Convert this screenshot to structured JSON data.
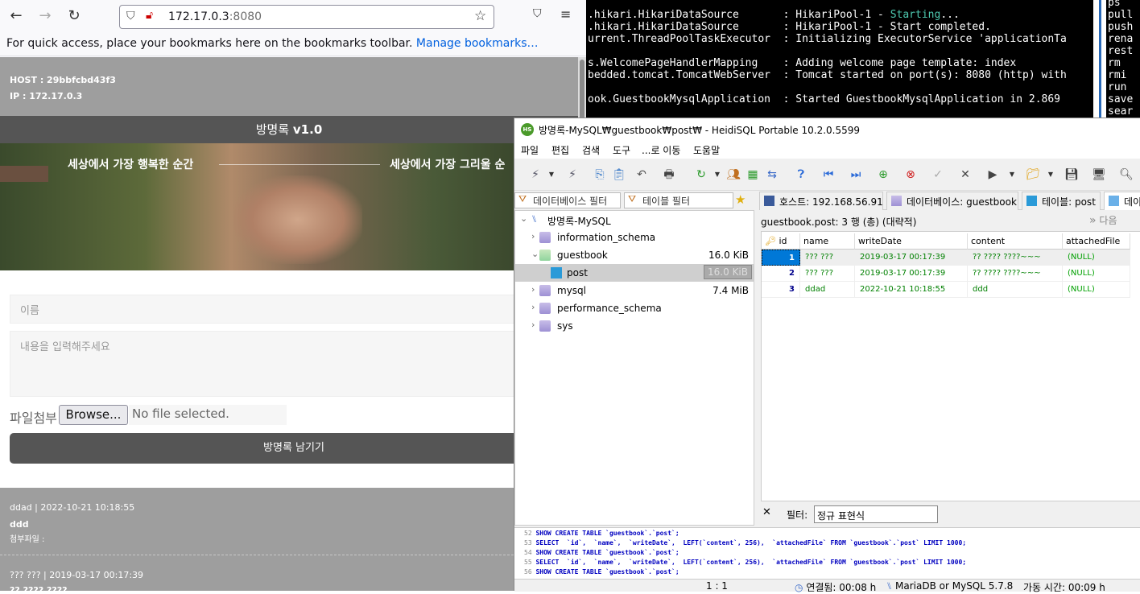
{
  "browser": {
    "url_host": "172.17.0.3",
    "url_port": ":8080",
    "bookmarks_message": "For quick access, place your bookmarks here on the bookmarks toolbar.",
    "manage_bookmarks": "Manage bookmarks…"
  },
  "guestbook": {
    "host": "HOST : 29bbfcbd43f3",
    "ip": "IP : 172.17.0.3",
    "title_prefix": "방명록 ",
    "title_version": "v1.0",
    "hero_text_left": "세상에서 가장 행복한 순간",
    "hero_text_right": "세상에서 가장 그리울 순",
    "name_placeholder": "이름",
    "content_placeholder": "내용을 입력해주세요",
    "attach_label": "파일첨부",
    "browse_label": "Browse...",
    "no_file": "No file selected.",
    "submit_label": "방명록 남기기",
    "entries": [
      {
        "meta": "ddad |   2022-10-21 10:18:55",
        "content": "ddd",
        "file": "첨부파일 :"
      },
      {
        "meta": "??? ??? |   2019-03-17 00:17:39",
        "content": "?? ???? ????"
      }
    ]
  },
  "terminal": {
    "lines": [
      {
        "a": ".hikari.HikariDataSource       : HikariPool-1 - ",
        "b": "Starting",
        "c": "..."
      },
      {
        "a": ".hikari.HikariDataSource       : HikariPool-1 - Start completed."
      },
      {
        "a": "urrent.ThreadPoolTaskExecutor  : Initializing ExecutorService 'applicationTa"
      },
      {
        "a": ""
      },
      {
        "a": "s.WelcomePageHandlerMapping    : Adding welcome page template: index"
      },
      {
        "a": "bedded.tomcat.TomcatWebServer  : Tomcat started on port(s): 8080 (http) with"
      },
      {
        "a": ""
      },
      {
        "a": "ook.GuestbookMysqlApplication  : Started GuestbookMysqlApplication in 2.869"
      }
    ],
    "right_lines": [
      "ps",
      "pull",
      "push",
      "rena",
      "rest",
      "rm",
      "rmi",
      "run",
      "save",
      "sear"
    ]
  },
  "heidisql": {
    "window_title": "방명록-MySQL₩guestbook₩post₩ - HeidiSQL Portable 10.2.0.5599",
    "logo": "HS",
    "menus": [
      "파일",
      "편집",
      "검색",
      "도구",
      "...로 이동",
      "도움말"
    ],
    "db_filter": "데이터베이스 필터",
    "table_filter": "테이블 필터",
    "tabs": [
      "호스트: 192.168.56.91",
      "데이터베이스: guestbook",
      "테이블: post",
      "데이"
    ],
    "tree": {
      "root": "방명록-MySQL",
      "items": [
        {
          "name": "information_schema",
          "size": ""
        },
        {
          "name": "guestbook",
          "size": "16.0 KiB"
        },
        {
          "name": "post",
          "size": "16.0 KiB"
        },
        {
          "name": "mysql",
          "size": "7.4 MiB"
        },
        {
          "name": "performance_schema",
          "size": ""
        },
        {
          "name": "sys",
          "size": ""
        }
      ]
    },
    "grid_caption": "guestbook.post: 3 행 (총) (대략적)",
    "next_label": "다음",
    "columns": [
      "id",
      "name",
      "writeDate",
      "content",
      "attachedFile"
    ],
    "rows": [
      [
        "1",
        "??? ???",
        "2019-03-17 00:17:39",
        "?? ???? ????~~~",
        "(NULL)"
      ],
      [
        "2",
        "??? ???",
        "2019-03-17 00:17:39",
        "?? ???? ????~~~",
        "(NULL)"
      ],
      [
        "3",
        "ddad",
        "2022-10-21 10:18:55",
        "ddd",
        "(NULL)"
      ]
    ],
    "filter_label": "필터:",
    "filter_value": "정규 표현식",
    "sql_log": [
      {
        "n": "52",
        "t": "SHOW CREATE TABLE `guestbook`.`post`;"
      },
      {
        "n": "53",
        "t": "SELECT  `id`,  `name`,  `writeDate`,  LEFT(`content`, 256),  `attachedFile` FROM `guestbook`.`post` LIMIT 1000;"
      },
      {
        "n": "54",
        "t": "SHOW CREATE TABLE `guestbook`.`post`;"
      },
      {
        "n": "55",
        "t": "SELECT  `id`,  `name`,  `writeDate`,  LEFT(`content`, 256),  `attachedFile` FROM `guestbook`.`post` LIMIT 1000;"
      },
      {
        "n": "56",
        "t": "SHOW CREATE TABLE `guestbook`.`post`;"
      }
    ],
    "status": {
      "pos": "1 : 1",
      "connected": "연결됨: 00:08 h",
      "server": "MariaDB or MySQL 5.7.8",
      "uptime": "가동 시간: 00:09 h"
    }
  }
}
